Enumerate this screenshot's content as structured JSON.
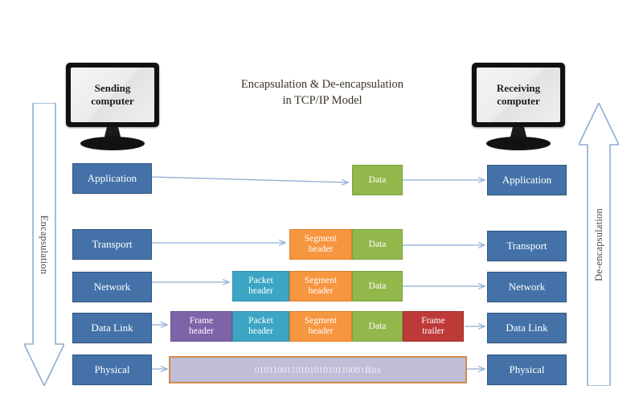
{
  "diagram": {
    "title_line1": "Encapsulation & De-encapsulation",
    "title_line2": "in TCP/IP Model",
    "sending_computer_line1": "Sending",
    "sending_computer_line2": "computer",
    "receiving_computer_line1": "Receiving",
    "receiving_computer_line2": "computer",
    "left_arrow_label": "Encapsulation",
    "right_arrow_label": "De-encapsulation",
    "bits_label": "01011001101010101011000١Bits"
  },
  "layers_left": [
    {
      "label": "Application"
    },
    {
      "label": "Transport"
    },
    {
      "label": "Network"
    },
    {
      "label": "Data Link"
    },
    {
      "label": "Physical"
    }
  ],
  "layers_right": [
    {
      "label": "Application"
    },
    {
      "label": "Transport"
    },
    {
      "label": "Network"
    },
    {
      "label": "Data Link"
    },
    {
      "label": "Physical"
    }
  ],
  "pdu_rows": [
    {
      "layer": "Application",
      "cells": [
        {
          "line1": "Data",
          "line2": "",
          "color": "#92b84c",
          "kind": "data"
        }
      ]
    },
    {
      "layer": "Transport",
      "cells": [
        {
          "line1": "Segment",
          "line2": "header",
          "color": "#f79640",
          "kind": "segment-header"
        },
        {
          "line1": "Data",
          "line2": "",
          "color": "#92b84c",
          "kind": "data"
        }
      ]
    },
    {
      "layer": "Network",
      "cells": [
        {
          "line1": "Packet",
          "line2": "header",
          "color": "#3da5c4",
          "kind": "packet-header"
        },
        {
          "line1": "Segment",
          "line2": "header",
          "color": "#f79640",
          "kind": "segment-header"
        },
        {
          "line1": "Data",
          "line2": "",
          "color": "#92b84c",
          "kind": "data"
        }
      ]
    },
    {
      "layer": "Data Link",
      "cells": [
        {
          "line1": "Frame",
          "line2": "header",
          "color": "#7e63a8",
          "kind": "frame-header"
        },
        {
          "line1": "Packet",
          "line2": "header",
          "color": "#3da5c4",
          "kind": "packet-header"
        },
        {
          "line1": "Segment",
          "line2": "header",
          "color": "#f79640",
          "kind": "segment-header"
        },
        {
          "line1": "Data",
          "line2": "",
          "color": "#92b84c",
          "kind": "data"
        },
        {
          "line1": "Frame",
          "line2": "trailer",
          "color": "#be3a38",
          "kind": "frame-trailer"
        }
      ]
    }
  ],
  "colors": {
    "layer_box": "#4472a8",
    "layer_border": "#2f5685",
    "arrow_line": "#8fadd4",
    "frame_header": "#7e63a8",
    "packet_header": "#3da5c4",
    "segment_header": "#f79640",
    "data": "#92b84c",
    "frame_trailer": "#be3a38",
    "bits_bar": "#bfbdd8",
    "bits_border": "#cf8a4e"
  }
}
